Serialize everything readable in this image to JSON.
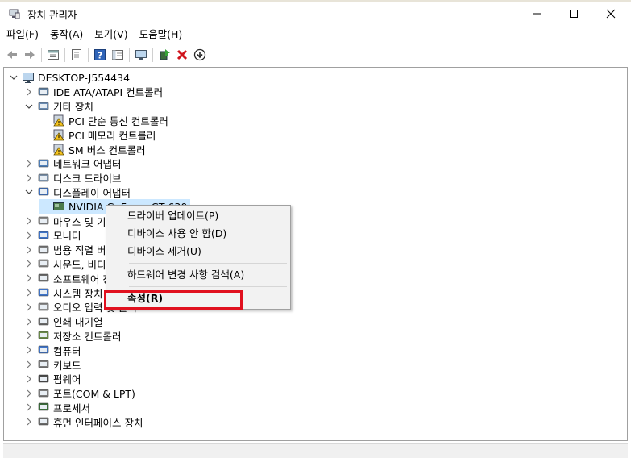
{
  "window": {
    "title": "장치 관리자",
    "controls": {
      "minimize": "minimize-icon",
      "maximize": "maximize-icon",
      "close": "close-icon"
    }
  },
  "menubar": [
    {
      "label": "파일(F)"
    },
    {
      "label": "동작(A)"
    },
    {
      "label": "보기(V)"
    },
    {
      "label": "도움말(H)"
    }
  ],
  "toolbar": [
    "back-icon",
    "forward-icon",
    "properties-icon",
    "show-hide-icon",
    "help-icon",
    "view-icon",
    "scan-hardware-icon",
    "update-driver-icon",
    "uninstall-icon",
    "download-icon"
  ],
  "tree": {
    "root": "DESKTOP-J554434",
    "items": [
      {
        "label": "IDE ATA/ATAPI 컨트롤러",
        "expanded": false
      },
      {
        "label": "기타 장치",
        "expanded": true,
        "children": [
          "PCI 단순 통신 컨트롤러",
          "PCI 메모리 컨트롤러",
          "SM 버스 컨트롤러"
        ]
      },
      {
        "label": "네트워크 어댑터",
        "expanded": false
      },
      {
        "label": "디스크 드라이브",
        "expanded": false
      },
      {
        "label": "디스플레이 어댑터",
        "expanded": true,
        "children": [
          "NVIDIA GeForce GT 630"
        ]
      },
      {
        "label": "마우스 및 기타 포인팅 장치",
        "expanded": false
      },
      {
        "label": "모니터",
        "expanded": false
      },
      {
        "label": "범용 직렬 버스 컨트롤러",
        "expanded": false
      },
      {
        "label": "사운드, 비디오 및 게임 컨트롤러",
        "expanded": false
      },
      {
        "label": "소프트웨어 장치",
        "expanded": false
      },
      {
        "label": "시스템 장치",
        "expanded": false
      },
      {
        "label": "오디오 입력 및 출력",
        "expanded": false
      },
      {
        "label": "인쇄 대기열",
        "expanded": false
      },
      {
        "label": "저장소 컨트롤러",
        "expanded": false
      },
      {
        "label": "컴퓨터",
        "expanded": false
      },
      {
        "label": "키보드",
        "expanded": false
      },
      {
        "label": "펌웨어",
        "expanded": false
      },
      {
        "label": "포트(COM & LPT)",
        "expanded": false
      },
      {
        "label": "프로세서",
        "expanded": false
      },
      {
        "label": "휴먼 인터페이스 장치",
        "expanded": false
      }
    ]
  },
  "context_menu": {
    "items": [
      {
        "label": "드라이버 업데이트(P)"
      },
      {
        "label": "디바이스 사용 안 함(D)"
      },
      {
        "label": "디바이스 제거(U)"
      },
      {
        "label": "하드웨어 변경 사항 검색(A)"
      },
      {
        "label": "속성(R)",
        "highlighted": true
      }
    ]
  },
  "colors": {
    "highlight_box": "#e0101e",
    "close_x": "#d0141c",
    "selection_bg": "#cce8ff"
  }
}
